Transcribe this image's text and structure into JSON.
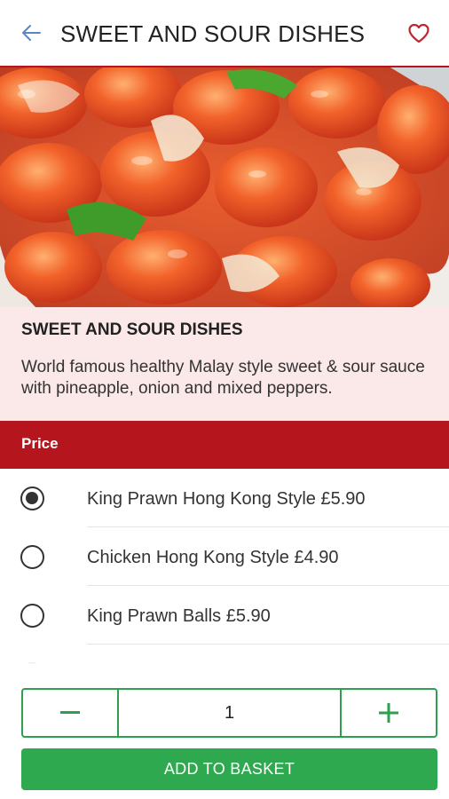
{
  "header": {
    "title": "SWEET AND SOUR DISHES",
    "back_icon": "arrow-left-icon",
    "favorite_icon": "heart-outline-icon"
  },
  "hero": {
    "image": "photo of sweet and sour dish"
  },
  "info": {
    "title": "SWEET AND SOUR DISHES",
    "description": "World famous healthy Malay style sweet & sour sauce with pineapple, onion and mixed peppers."
  },
  "price_section": {
    "label": "Price"
  },
  "options": [
    {
      "label": "King Prawn Hong Kong Style",
      "price": "£5.90",
      "selected": true
    },
    {
      "label": "Chicken Hong Kong Style",
      "price": "£4.90",
      "selected": false
    },
    {
      "label": "King Prawn Balls",
      "price": "£5.90",
      "selected": false
    }
  ],
  "quantity": {
    "value": "1",
    "minus_icon": "minus-icon",
    "plus_icon": "plus-icon"
  },
  "basket_button": {
    "label": "ADD TO BASKET"
  },
  "colors": {
    "brand_red": "#b5161e",
    "info_background": "#fbe8e8",
    "action_green": "#2fa94f",
    "back_icon": "#5a86c4"
  }
}
